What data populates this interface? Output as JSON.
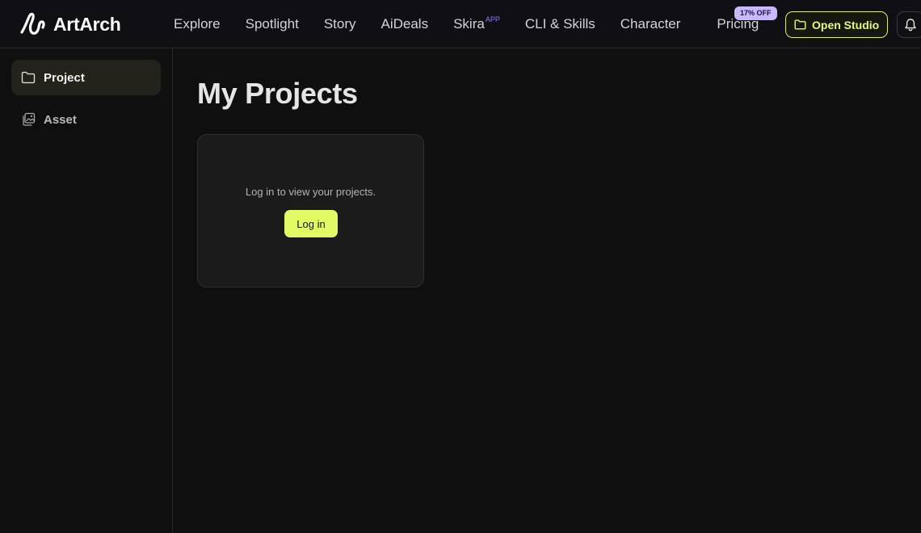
{
  "brand": {
    "name": "ArtArch"
  },
  "nav": {
    "items": [
      {
        "label": "Explore"
      },
      {
        "label": "Spotlight"
      },
      {
        "label": "Story"
      },
      {
        "label": "AiDeals"
      },
      {
        "label": "Skira",
        "superscript": "APP"
      },
      {
        "label": "CLI & Skills"
      },
      {
        "label": "Character"
      },
      {
        "label": "Pricing"
      }
    ],
    "pricing_badge": "17% OFF",
    "open_studio_label": "Open Studio"
  },
  "sidebar": {
    "items": [
      {
        "label": "Project",
        "icon": "folder-icon",
        "active": true
      },
      {
        "label": "Asset",
        "icon": "image-stack-icon",
        "active": false
      }
    ]
  },
  "main": {
    "title": "My Projects",
    "login_card": {
      "message": "Log in to view your projects.",
      "button_label": "Log in"
    }
  },
  "colors": {
    "accent": "#e2fb64",
    "badge_bg": "#c9b8ff",
    "superscript": "#8b7cf6",
    "background": "#0f0f0f"
  }
}
